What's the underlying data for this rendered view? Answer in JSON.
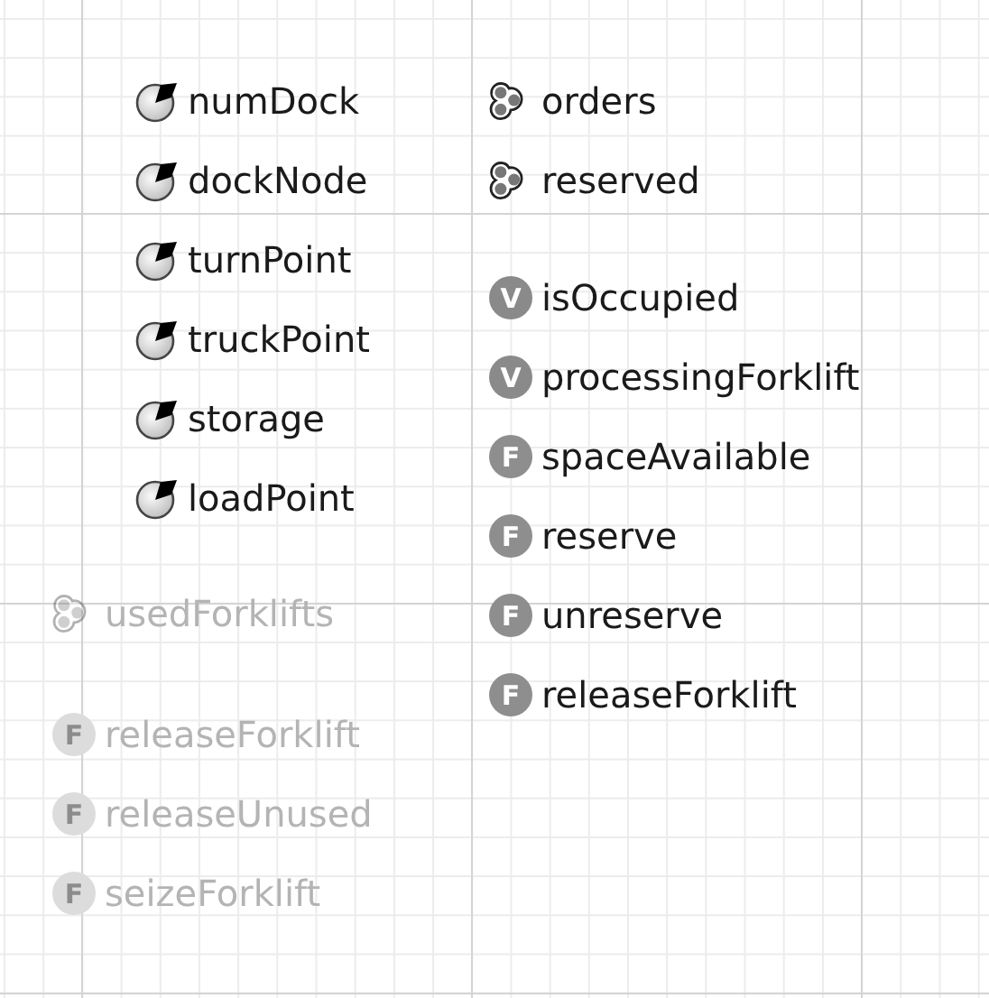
{
  "groups": [
    {
      "items": [
        {
          "kind": "parameter",
          "label": "numDock",
          "disabled": false
        },
        {
          "kind": "parameter",
          "label": "dockNode",
          "disabled": false
        },
        {
          "kind": "parameter",
          "label": "turnPoint",
          "disabled": false
        },
        {
          "kind": "parameter",
          "label": "truckPoint",
          "disabled": false
        },
        {
          "kind": "parameter",
          "label": "storage",
          "disabled": false
        },
        {
          "kind": "parameter",
          "label": "loadPoint",
          "disabled": false
        }
      ]
    },
    {
      "items": [
        {
          "kind": "collection",
          "label": "orders",
          "disabled": false
        },
        {
          "kind": "collection",
          "label": "reserved",
          "disabled": false
        }
      ]
    },
    {
      "items": [
        {
          "kind": "variable",
          "letter": "V",
          "label": "isOccupied",
          "disabled": false
        },
        {
          "kind": "variable",
          "letter": "V",
          "label": "processingForklift",
          "disabled": false
        },
        {
          "kind": "function",
          "letter": "F",
          "label": "spaceAvailable",
          "disabled": false
        },
        {
          "kind": "function",
          "letter": "F",
          "label": "reserve",
          "disabled": false
        },
        {
          "kind": "function",
          "letter": "F",
          "label": "unreserve",
          "disabled": false
        },
        {
          "kind": "function",
          "letter": "F",
          "label": "releaseForklift",
          "disabled": false
        }
      ]
    },
    {
      "items": [
        {
          "kind": "collection",
          "label": "usedForklifts",
          "disabled": true
        }
      ]
    },
    {
      "items": [
        {
          "kind": "function",
          "letter": "F",
          "label": "releaseForklift",
          "disabled": true
        },
        {
          "kind": "function",
          "letter": "F",
          "label": "releaseUnused",
          "disabled": true
        },
        {
          "kind": "function",
          "letter": "F",
          "label": "seizeForklift",
          "disabled": true
        }
      ]
    }
  ]
}
